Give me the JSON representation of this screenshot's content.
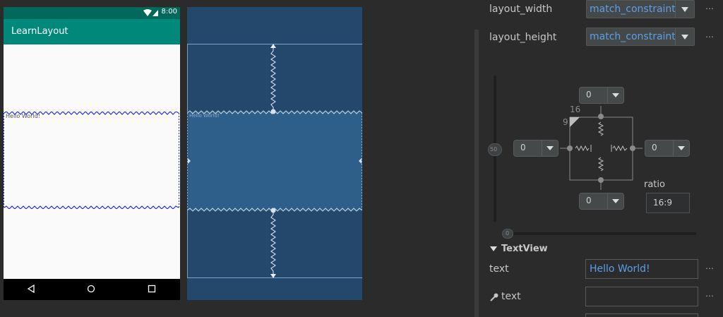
{
  "phone": {
    "status_time": "8:00",
    "app_title": "LearnLayout",
    "textview_text": "Hello World!"
  },
  "blueprint": {
    "textview_text": "Hello World!"
  },
  "attributes": {
    "layout_width": {
      "label": "layout_width",
      "value": "match_constraint"
    },
    "layout_height": {
      "label": "layout_height",
      "value": "match_constraint"
    },
    "more_label": "⋯",
    "constraint_widget": {
      "top_margin": "0",
      "bottom_margin": "0",
      "left_margin": "0",
      "right_margin": "0",
      "vertical_bias": "50",
      "horizontal_bias": "0",
      "ratio_width": "16",
      "ratio_height": "9",
      "ratio_label": "ratio",
      "ratio_value": "16:9"
    },
    "section": {
      "title": "TextView"
    },
    "text_field": {
      "label": "text",
      "value": "Hello World!"
    },
    "tools_text_field": {
      "label": "text",
      "value": ""
    }
  },
  "colors": {
    "accent_blue": "#5c9fe8",
    "status_bar": "#00695c",
    "app_bar": "#00897b",
    "blueprint_bg": "#23486b",
    "blueprint_selected": "#2d5f8a",
    "selection_outline": "#2a2adf"
  }
}
